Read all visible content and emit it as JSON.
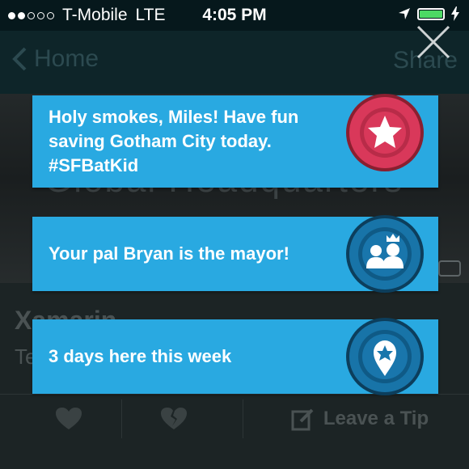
{
  "status_bar": {
    "carrier": "T-Mobile",
    "network": "LTE",
    "time": "4:05 PM"
  },
  "nav": {
    "back_label": "Home",
    "share_label": "Share"
  },
  "background": {
    "banner_text": "Global Headquarters",
    "venue_name": "Xamarin",
    "venue_sub": "Te"
  },
  "actions": {
    "tip_label": "Leave a Tip"
  },
  "notifications": [
    {
      "text": "Holy smokes, Miles! Have fun saving Gotham City today. #SFBatKid",
      "badge_icon": "star-icon",
      "badge_color": "#d9385a"
    },
    {
      "text": "Your pal Bryan is the mayor!",
      "badge_icon": "mayor-crown-icon",
      "badge_color": "#1874a8"
    },
    {
      "text": "3 days here this week",
      "badge_icon": "map-pin-star-icon",
      "badge_color": "#1874a8"
    }
  ],
  "colors": {
    "card": "#29a9e1",
    "status_bg": "#06181c",
    "battery": "#4cd964"
  }
}
